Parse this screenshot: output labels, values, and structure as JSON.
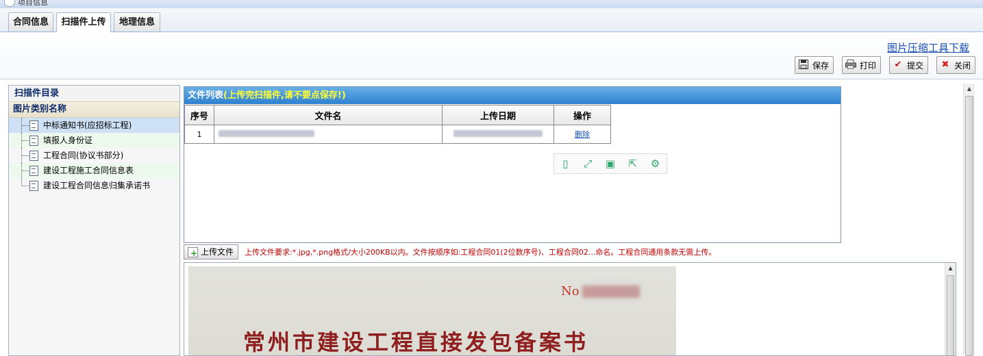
{
  "window": {
    "title": "项目信息"
  },
  "tabs": [
    {
      "label": "合同信息",
      "active": false
    },
    {
      "label": "扫描件上传",
      "active": true
    },
    {
      "label": "地理信息",
      "active": false
    }
  ],
  "header": {
    "download_link": "图片压缩工具下载"
  },
  "toolbar": {
    "save": "保存",
    "print": "打印",
    "submit": "提交",
    "close": "关闭"
  },
  "left_panel": {
    "title": "扫描件目录",
    "column_header": "图片类别名称",
    "items": [
      {
        "label": "中标通知书(应招标工程)",
        "selected": true
      },
      {
        "label": "填报人身份证"
      },
      {
        "label": "工程合同(协议书部分)"
      },
      {
        "label": "建设工程施工合同信息表"
      },
      {
        "label": "建设工程合同信息归集承诺书"
      }
    ]
  },
  "file_list": {
    "title": "文件列表",
    "hint": "(上传完扫描件,请不要点保存!)",
    "columns": [
      "序号",
      "文件名",
      "上传日期",
      "操作"
    ],
    "rows": [
      {
        "index": "1",
        "action": "删除"
      }
    ]
  },
  "upload": {
    "button": "上传文件",
    "hint": "上传文件要求:*.jpg,*.png格式/大小200KB以内。文件按顺序如:工程合同01(2位数序号)、工程合同02...命名。工程合同通用条款无需上传。"
  },
  "preview": {
    "doc_number_label": "No",
    "doc_title": "常州市建设工程直接发包备案书"
  },
  "colors": {
    "header_blue": "#2d7fcf",
    "hint_yellow": "#ffff33",
    "warning_red": "#c00000",
    "link_blue": "#1a4fb4"
  }
}
